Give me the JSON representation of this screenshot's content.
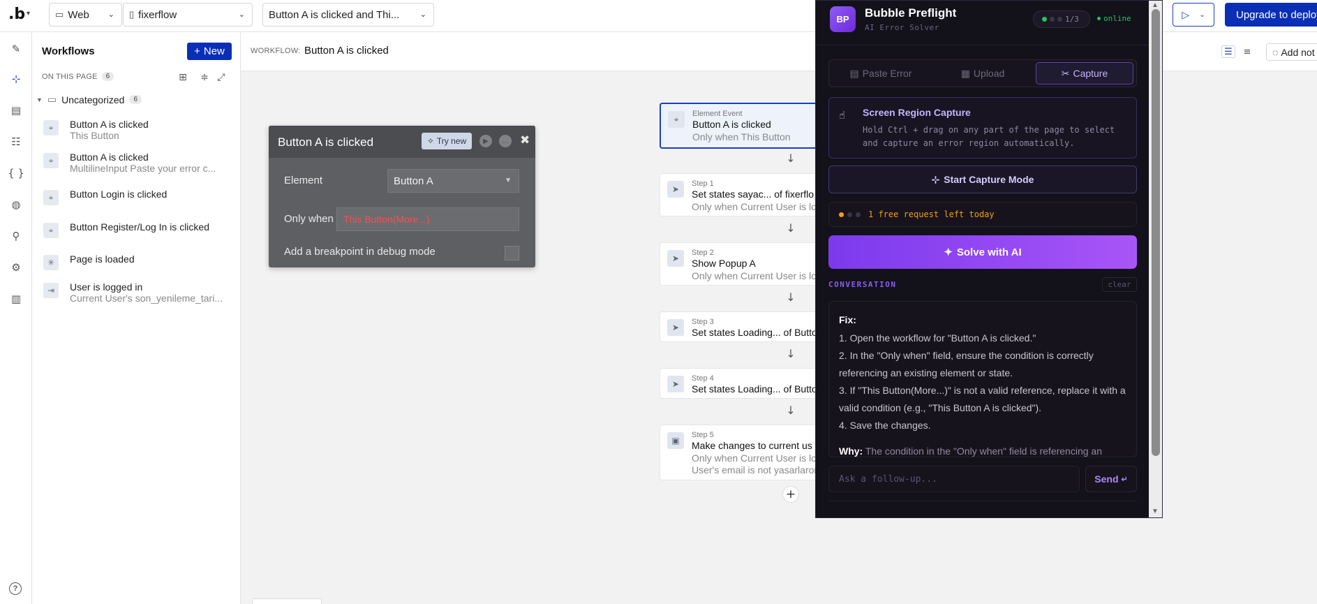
{
  "topbar": {
    "logo": ".b",
    "platform": "Web",
    "page": "fixerflow",
    "event_select": "Button A is clicked and Thi...",
    "upgrade_label": "Upgrade to deploy"
  },
  "sidebar": {
    "title": "Workflows",
    "new_label": "New",
    "on_this_page_label": "ON THIS PAGE",
    "on_this_page_count": "6",
    "folder_name": "Uncategorized",
    "folder_count": "6",
    "items": [
      {
        "name": "Button A is clicked",
        "sub": "This Button",
        "icon": "pointer-icon"
      },
      {
        "name": "Button A is clicked",
        "sub": "MultilineInput Paste your error c...",
        "icon": "pointer-icon"
      },
      {
        "name": "Button Login is clicked",
        "sub": "",
        "icon": "pointer-icon"
      },
      {
        "name": "Button Register/Log In is clicked",
        "sub": "",
        "icon": "pointer-icon"
      },
      {
        "name": "Page is loaded",
        "sub": "",
        "icon": "loading-icon"
      },
      {
        "name": "User is logged in",
        "sub": "Current User's son_yenileme_tari...",
        "icon": "login-icon"
      }
    ]
  },
  "workflow_header": {
    "label": "WORKFLOW:",
    "name": "Button A is clicked",
    "add_note": "Add not"
  },
  "event_panel": {
    "title": "Button A is clicked",
    "try_new": "Try new",
    "element_label": "Element",
    "element_value": "Button A",
    "only_when_label": "Only when",
    "only_when_value": "This Button(More...)",
    "breakpoint_label": "Add a breakpoint in debug mode",
    "error_color": "#ff4d4f"
  },
  "steps": [
    {
      "kicker": "Element Event",
      "title": "Button A is clicked",
      "cond": "Only when This Button",
      "cond2": "",
      "icon": "pointer-icon"
    },
    {
      "kicker": "Step 1",
      "title": "Set states sayac... of fixerflo",
      "cond": "Only when Current User is lo",
      "cond2": "",
      "icon": "cursor-icon"
    },
    {
      "kicker": "Step 2",
      "title": "Show Popup A",
      "cond": "Only when Current User is lo",
      "cond2": "",
      "icon": "cursor-icon"
    },
    {
      "kicker": "Step 3",
      "title": "Set states Loading... of Butto",
      "cond": "",
      "cond2": "",
      "icon": "cursor-icon"
    },
    {
      "kicker": "Step 4",
      "title": "Set states Loading... of Butto",
      "cond": "",
      "cond2": "",
      "icon": "cursor-icon"
    },
    {
      "kicker": "Step 5",
      "title": "Make changes to current us",
      "cond": "Only when Current User is lo",
      "cond2": "User's email is not yasarlaron",
      "icon": "user-card-icon"
    }
  ],
  "preflight": {
    "badge": "BP",
    "title": "Bubble Preflight",
    "subtitle": "AI Error Solver",
    "counter": "1/3",
    "status": "online",
    "tabs": [
      "Paste Error",
      "Upload",
      "Capture"
    ],
    "active_tab": "Capture",
    "capture_title": "Screen Region Capture",
    "capture_desc": "Hold Ctrl + drag on any part of the page to select and capture an error region automatically.",
    "start_capture": "Start Capture Mode",
    "free_requests": "1 free request left today",
    "solve_label": "Solve with AI",
    "conversation_label": "CONVERSATION",
    "clear_label": "clear",
    "fix_heading": "Fix:",
    "fix_steps": [
      "1. Open the workflow for \"Button A is clicked.\"",
      "2. In the \"Only when\" field, ensure the condition is correctly referencing an existing element or state.",
      "3. If \"This Button(More...)\" is not a valid reference, replace it with a valid condition (e.g., \"This Button A is clicked\").",
      "4. Save the changes."
    ],
    "why_heading": "Why:",
    "why_text": "The condition in the \"Only when\" field is referencing an",
    "ask_placeholder": "Ask a follow-up...",
    "send_label": "Send",
    "accent_color": "#8b5cf6",
    "online_color": "#22c55e",
    "warning_color": "#f59e0b"
  }
}
